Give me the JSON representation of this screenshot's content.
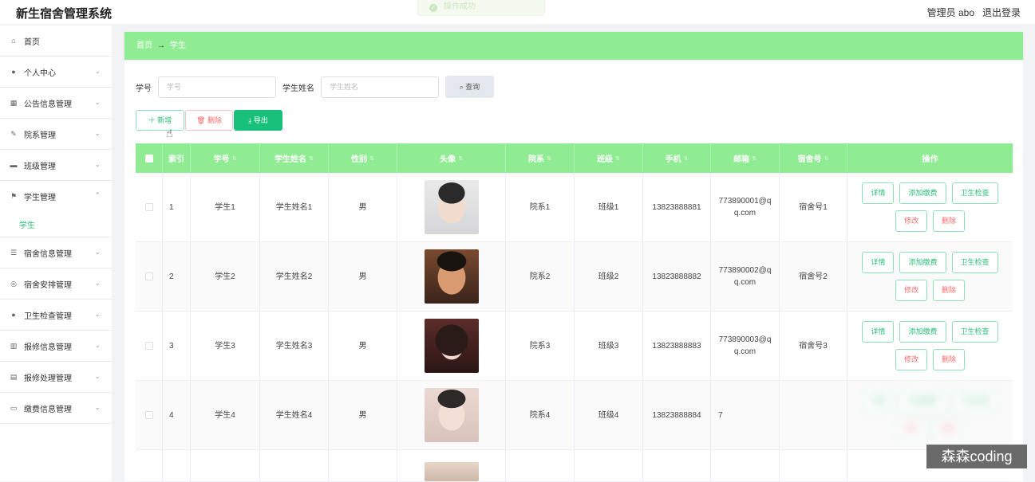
{
  "app": {
    "title": "新生宿舍管理系统"
  },
  "header": {
    "user": "管理员 abo",
    "logout": "退出登录"
  },
  "toast": {
    "text": "操作成功"
  },
  "sidebar": {
    "items": [
      {
        "label": "首页",
        "icon": "home-icon"
      },
      {
        "label": "个人中心",
        "icon": "user-icon"
      },
      {
        "label": "公告信息管理",
        "icon": "grid-icon"
      },
      {
        "label": "院系管理",
        "icon": "pen-icon"
      },
      {
        "label": "班级管理",
        "icon": "board-icon"
      },
      {
        "label": "学生管理",
        "icon": "flag-icon",
        "sub": "学生"
      },
      {
        "label": "宿舍信息管理",
        "icon": "list-icon"
      },
      {
        "label": "宿舍安排管理",
        "icon": "globe-icon"
      },
      {
        "label": "卫生检查管理",
        "icon": "user-icon"
      },
      {
        "label": "报修信息管理",
        "icon": "bar-chart-icon"
      },
      {
        "label": "报修处理管理",
        "icon": "clipboard-icon"
      },
      {
        "label": "缴费信息管理",
        "icon": "chat-icon"
      }
    ]
  },
  "breadcrumb": {
    "home": "首页",
    "arrow": "→",
    "current": "学生"
  },
  "search": {
    "id_label": "学号",
    "id_placeholder": "学号",
    "name_label": "学生姓名",
    "name_placeholder": "学生姓名",
    "button": "查询"
  },
  "actions": {
    "add": "新增",
    "delete": "删除",
    "export": "导出"
  },
  "table": {
    "headers": [
      "索引",
      "学号",
      "学生姓名",
      "性别",
      "头像",
      "院系",
      "班级",
      "手机",
      "邮箱",
      "宿舍号",
      "操作"
    ],
    "rows": [
      {
        "index": "1",
        "id": "学生1",
        "name": "学生姓名1",
        "gender": "男",
        "dept": "院系1",
        "cls": "班级1",
        "phone": "13823888881",
        "email_a": "773890001@q",
        "email_b": "q.com",
        "dorm": "宿舍号1"
      },
      {
        "index": "2",
        "id": "学生2",
        "name": "学生姓名2",
        "gender": "男",
        "dept": "院系2",
        "cls": "班级2",
        "phone": "13823888882",
        "email_a": "773890002@q",
        "email_b": "q.com",
        "dorm": "宿舍号2"
      },
      {
        "index": "3",
        "id": "学生3",
        "name": "学生姓名3",
        "gender": "男",
        "dept": "院系3",
        "cls": "班级3",
        "phone": "13823888883",
        "email_a": "773890003@q",
        "email_b": "q.com",
        "dorm": "宿舍号3"
      },
      {
        "index": "4",
        "id": "学生4",
        "name": "学生姓名4",
        "gender": "男",
        "dept": "院系4",
        "cls": "班级4",
        "phone": "13823888884",
        "email_a": "7",
        "email_b": "",
        "dorm": ""
      }
    ],
    "ops": {
      "detail": "详情",
      "pay": "添加缴费",
      "check": "卫生检查",
      "edit": "修改",
      "remove": "删除"
    }
  },
  "watermark": "森森coding",
  "colors": {
    "accent": "#90ec93",
    "primary": "#19c07c",
    "danger": "#f56c6c"
  }
}
